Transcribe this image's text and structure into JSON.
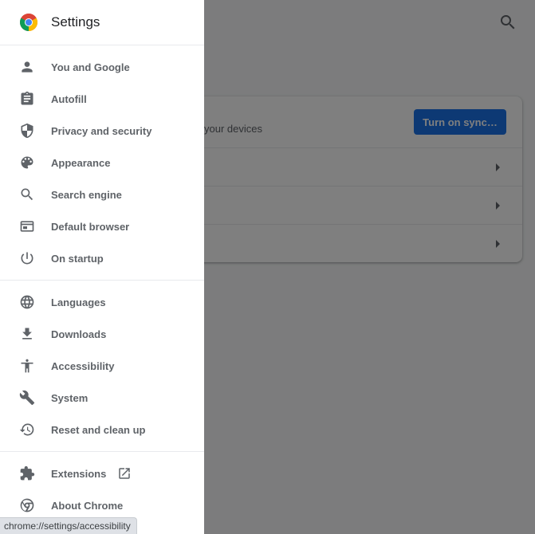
{
  "drawer": {
    "title": "Settings",
    "groups": [
      [
        {
          "label": "You and Google",
          "icon": "person-icon"
        },
        {
          "label": "Autofill",
          "icon": "clipboard-icon"
        },
        {
          "label": "Privacy and security",
          "icon": "shield-icon"
        },
        {
          "label": "Appearance",
          "icon": "palette-icon"
        },
        {
          "label": "Search engine",
          "icon": "search-icon"
        },
        {
          "label": "Default browser",
          "icon": "browser-window-icon"
        },
        {
          "label": "On startup",
          "icon": "power-icon"
        }
      ],
      [
        {
          "label": "Languages",
          "icon": "globe-icon"
        },
        {
          "label": "Downloads",
          "icon": "download-icon"
        },
        {
          "label": "Accessibility",
          "icon": "accessibility-icon"
        },
        {
          "label": "System",
          "icon": "wrench-icon"
        },
        {
          "label": "Reset and clean up",
          "icon": "restore-icon"
        }
      ],
      [
        {
          "label": "Extensions",
          "icon": "puzzle-icon"
        },
        {
          "label": "About Chrome",
          "icon": "chrome-icon"
        }
      ]
    ]
  },
  "background": {
    "sync_text": "your devices",
    "sync_button": "Turn on sync…"
  },
  "status_bar": {
    "url": "chrome://settings/accessibility"
  },
  "colors": {
    "accent": "#1a73e8",
    "icon": "#5f6368",
    "scrim": "rgba(0,0,0,0.5)"
  }
}
